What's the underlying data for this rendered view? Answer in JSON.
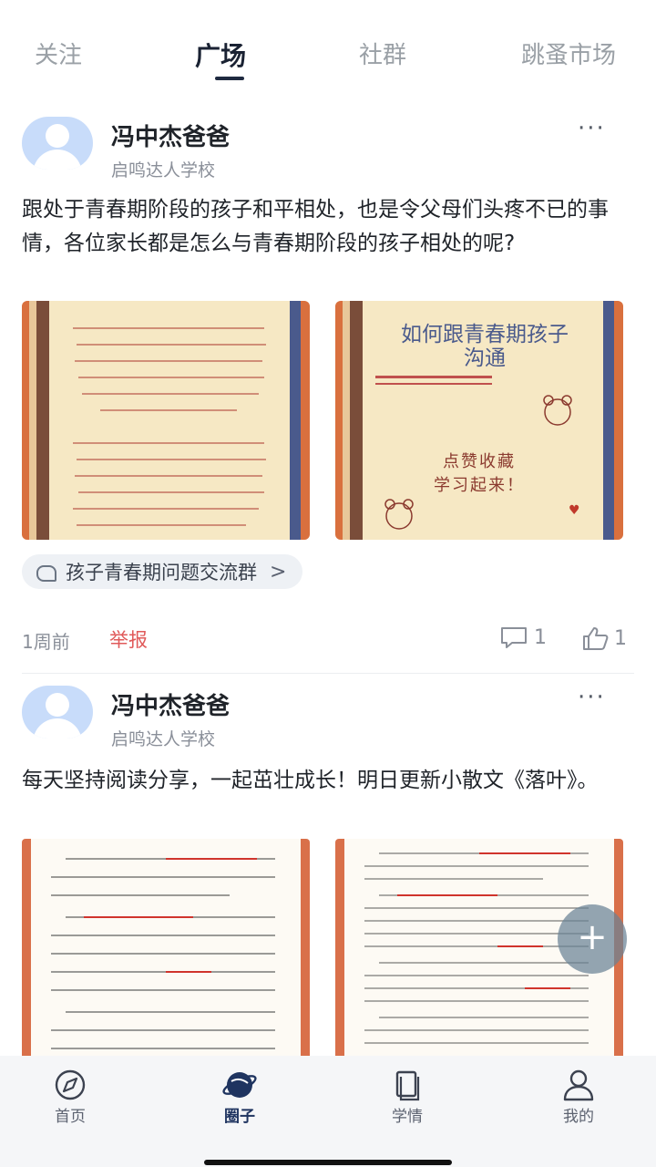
{
  "tabs": [
    {
      "label": "关注"
    },
    {
      "label": "广场"
    },
    {
      "label": "社群"
    },
    {
      "label": "跳蚤市场"
    }
  ],
  "posts": [
    {
      "author": "冯中杰爸爸",
      "school": "启鸣达人学校",
      "more": "···",
      "text": "跟处于青春期阶段的孩子和平相处，也是令父母们头疼不已的事情，各位家长都是怎么与青春期阶段的孩子相处的呢?",
      "image2_title": "如何跟青春期孩子沟通",
      "image2_sub1": "点赞收藏",
      "image2_sub2": "学习起来！",
      "group": "孩子青春期问题交流群",
      "group_arrow": ">",
      "time": "1周前",
      "report": "举报",
      "comments": "1",
      "likes": "1"
    },
    {
      "author": "冯中杰爸爸",
      "school": "启鸣达人学校",
      "more": "···",
      "text": "每天坚持阅读分享，一起茁壮成长！明日更新小散文《落叶》。"
    }
  ],
  "fab": {
    "label": "+"
  },
  "nav": [
    {
      "label": "首页",
      "icon": "compass-icon"
    },
    {
      "label": "圈子",
      "icon": "planet-icon"
    },
    {
      "label": "学情",
      "icon": "book-icon"
    },
    {
      "label": "我的",
      "icon": "person-icon"
    }
  ],
  "colors": {
    "accent": "#1f3460",
    "report": "#e05a5a",
    "avatar_bg": "#c8dcfa",
    "card_bg": "#f6e8c4"
  }
}
